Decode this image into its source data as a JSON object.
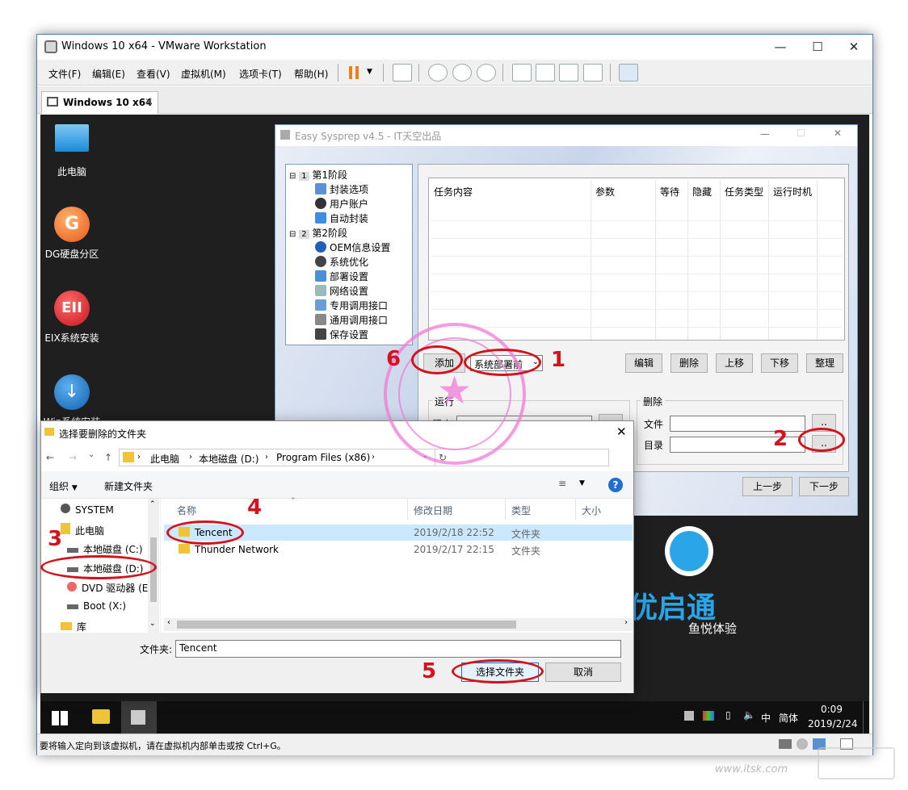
{
  "vmware": {
    "title": "Windows 10 x64 - VMware Workstation",
    "menu": [
      "文件(F)",
      "编辑(E)",
      "查看(V)",
      "虚拟机(M)",
      "选项卡(T)",
      "帮助(H)"
    ],
    "tab": "Windows 10 x64",
    "status": "要将输入定向到该虚拟机，请在虚拟机内部单击或按 Ctrl+G。"
  },
  "desktop": {
    "icons": [
      "此电脑",
      "DG硬盘分区",
      "EIX系统安装",
      "Win系统安装"
    ]
  },
  "sysprep": {
    "title": "Easy Sysprep v4.5 - IT天空出品",
    "tree": {
      "stage1": "第1阶段",
      "stage1_num": "1",
      "items1": [
        "封装选项",
        "用户账户",
        "自动封装"
      ],
      "stage2": "第2阶段",
      "stage2_num": "2",
      "items2": [
        "OEM信息设置",
        "系统优化",
        "部署设置",
        "网络设置",
        "专用调用接口",
        "通用调用接口",
        "保存设置"
      ]
    },
    "columns": [
      "任务内容",
      "参数",
      "等待",
      "隐藏",
      "任务类型",
      "运行时机"
    ],
    "add": "添加",
    "timing": "系统部署前",
    "edit": "编辑",
    "delete": "删除",
    "up": "上移",
    "down": "下移",
    "tidy": "整理",
    "run_group": "运行",
    "program_label": "程序",
    "delete_group": "删除",
    "file_label": "文件",
    "dir_label": "目录",
    "browse": "..",
    "prev": "上一步",
    "next": "下一步"
  },
  "dialog": {
    "title": "选择要删除的文件夹",
    "path": [
      "此电脑",
      "本地磁盘 (D:)",
      "Program Files (x86)"
    ],
    "organize": "组织",
    "new_folder": "新建文件夹",
    "nav": [
      "SYSTEM",
      "此电脑",
      "本地磁盘 (C:)",
      "本地磁盘 (D:)",
      "DVD 驱动器 (E",
      "Boot (X:)",
      "库"
    ],
    "columns": [
      "名称",
      "修改日期",
      "类型",
      "大小"
    ],
    "rows": [
      {
        "name": "Tencent",
        "date": "2019/2/18 22:52",
        "type": "文件夹"
      },
      {
        "name": "Thunder Network",
        "date": "2019/2/17 22:15",
        "type": "文件夹"
      }
    ],
    "folder_label": "文件夹:",
    "folder_value": "Tencent",
    "select": "选择文件夹",
    "cancel": "取消"
  },
  "tray": {
    "ime": "中",
    "lang": "简体",
    "time": "0:09",
    "date": "2019/2/24"
  },
  "brand": {
    "text": "鱼悦体验",
    "big": "优启通"
  },
  "watermark": "www.itsk.com",
  "annotations": [
    "1",
    "2",
    "3",
    "4",
    "5",
    "6"
  ]
}
